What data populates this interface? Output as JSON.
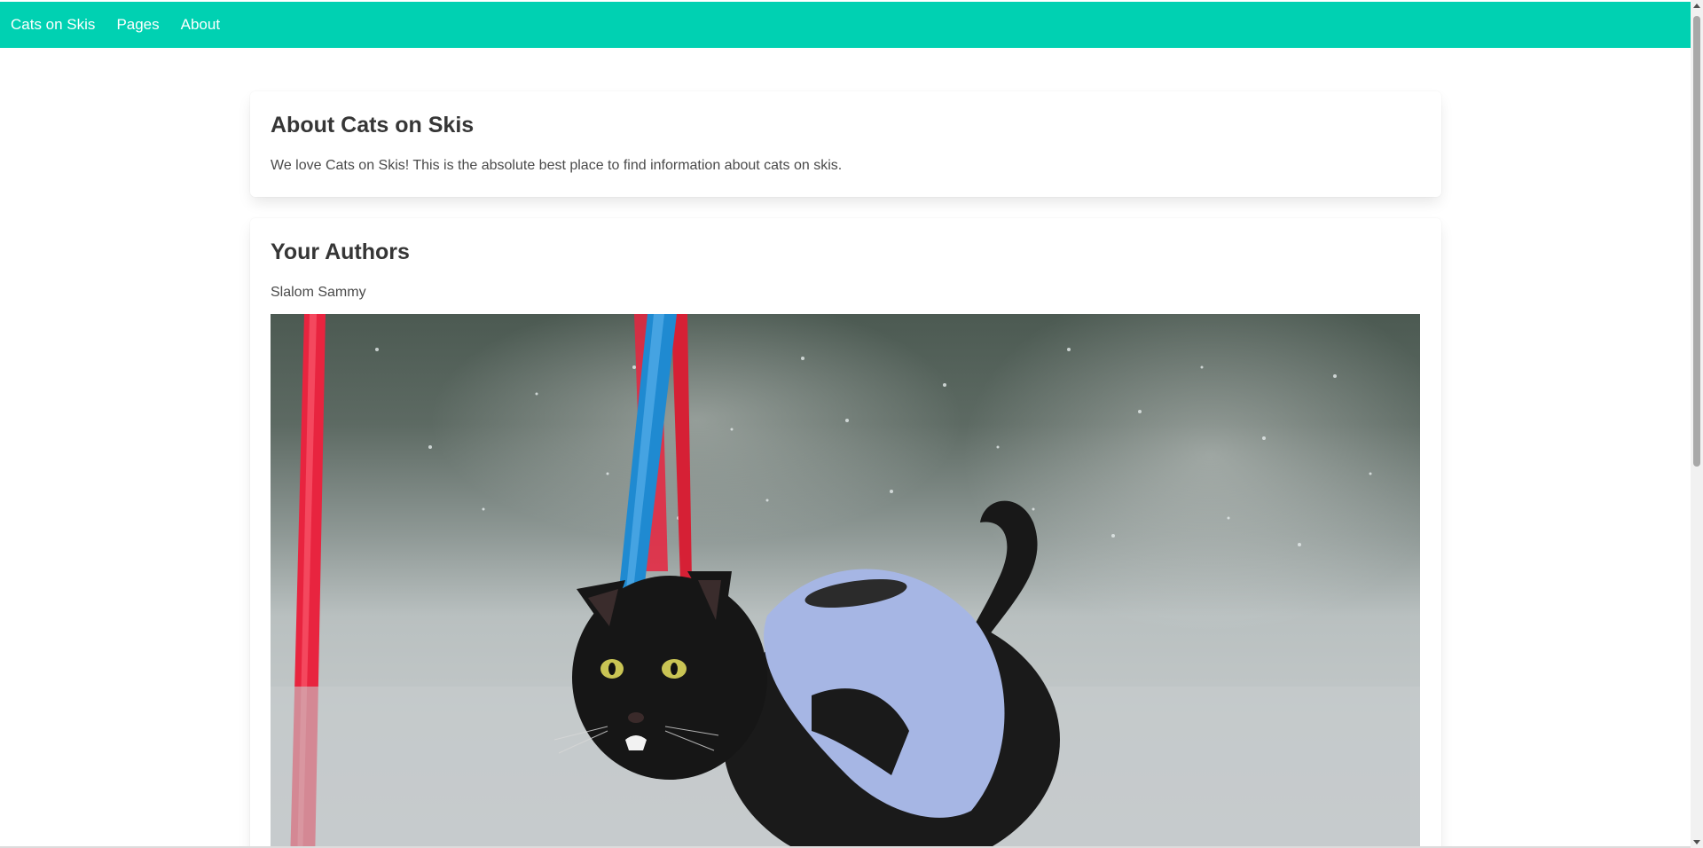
{
  "navbar": {
    "brand": "Cats on Skis",
    "items": [
      "Pages",
      "About"
    ],
    "color": "#00d1b2"
  },
  "about": {
    "title": "About Cats on Skis",
    "text": "We love Cats on Skis! This is the absolute best place to find information about cats on skis."
  },
  "authors": {
    "title": "Your Authors",
    "name": "Slalom Sammy",
    "photo_alt": "Slalom Sammy"
  }
}
